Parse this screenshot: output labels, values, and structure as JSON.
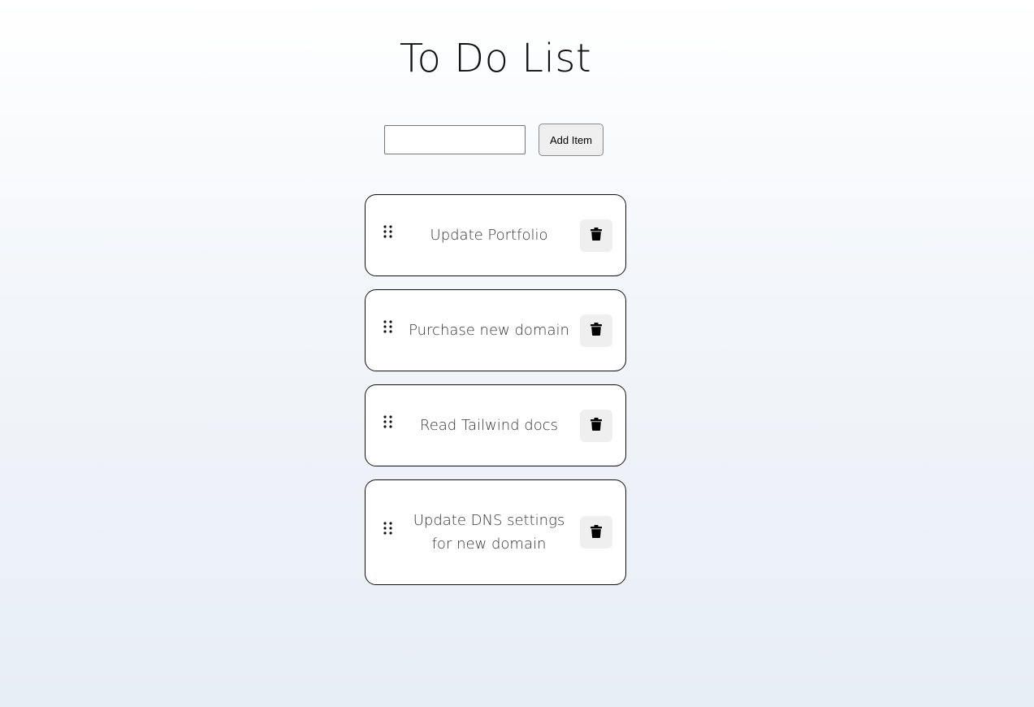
{
  "header": {
    "title": "To Do List"
  },
  "add_form": {
    "input_value": "",
    "input_placeholder": "",
    "button_label": "Add Item"
  },
  "todo_list": {
    "items": [
      {
        "label": "Update Portfolio",
        "drag_icon": "drag-handle-icon",
        "delete_icon": "trash-icon"
      },
      {
        "label": "Purchase new domain",
        "drag_icon": "drag-handle-icon",
        "delete_icon": "trash-icon"
      },
      {
        "label": "Read Tailwind docs",
        "drag_icon": "drag-handle-icon",
        "delete_icon": "trash-icon"
      },
      {
        "label": "Update DNS settings for new domain",
        "drag_icon": "drag-handle-icon",
        "delete_icon": "trash-icon"
      }
    ]
  },
  "colors": {
    "background_top": "#ffffff",
    "background_bottom": "#e8eef6",
    "card_border": "#111111",
    "delete_button_bg": "#efefef"
  }
}
